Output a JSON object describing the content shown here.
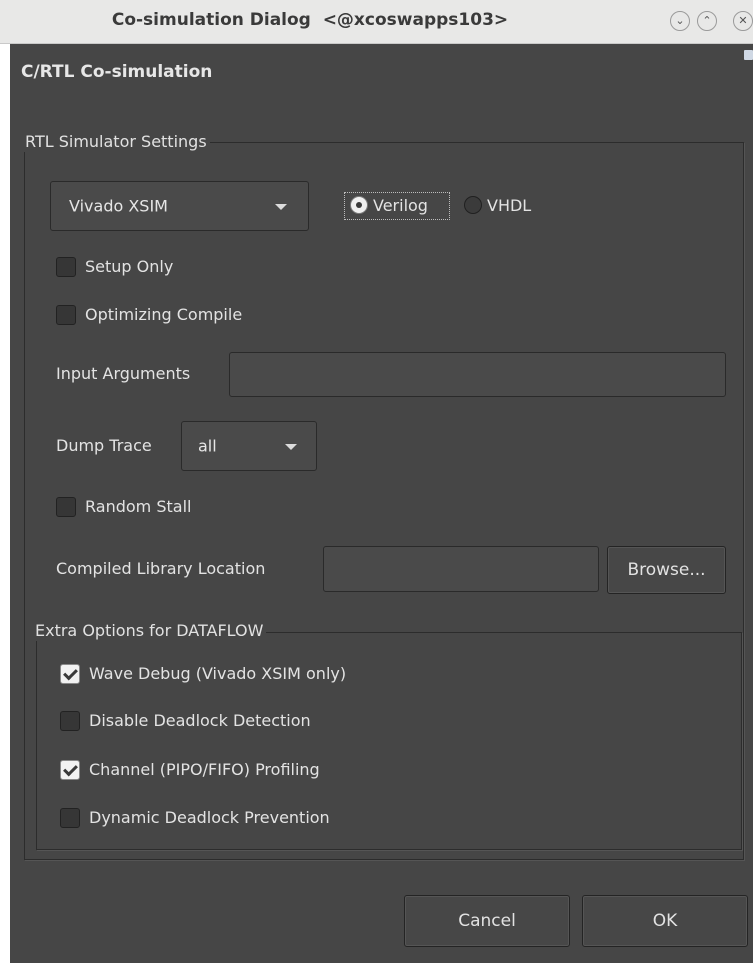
{
  "window": {
    "title": "Co-simulation Dialog  <@xcoswapps103>",
    "controls": [
      "minimize",
      "maximize",
      "close"
    ],
    "minimize_glyph": "⌄",
    "maximize_glyph": "⌃",
    "close_glyph": "✕"
  },
  "dialog": {
    "heading": "C/RTL Co-simulation"
  },
  "rtl_settings": {
    "group_title": "RTL Simulator Settings",
    "simulator": {
      "selected": "Vivado XSIM"
    },
    "language": {
      "options": [
        {
          "label": "Verilog",
          "selected": true
        },
        {
          "label": "VHDL",
          "selected": false
        }
      ]
    },
    "setup_only": {
      "label": "Setup Only",
      "checked": false
    },
    "optimizing_compile": {
      "label": "Optimizing Compile",
      "checked": false
    },
    "input_arguments": {
      "label": "Input Arguments",
      "value": ""
    },
    "dump_trace": {
      "label": "Dump Trace",
      "selected": "all"
    },
    "random_stall": {
      "label": "Random Stall",
      "checked": false
    },
    "compiled_library": {
      "label": "Compiled Library Location",
      "value": "",
      "browse_label": "Browse..."
    }
  },
  "dataflow": {
    "group_title": "Extra Options for DATAFLOW",
    "options": [
      {
        "label": "Wave Debug (Vivado XSIM only)",
        "checked": true
      },
      {
        "label": "Disable Deadlock Detection",
        "checked": false
      },
      {
        "label": "Channel (PIPO/FIFO) Profiling",
        "checked": true
      },
      {
        "label": "Dynamic Deadlock Prevention",
        "checked": false
      }
    ]
  },
  "footer": {
    "cancel_label": "Cancel",
    "ok_label": "OK"
  }
}
